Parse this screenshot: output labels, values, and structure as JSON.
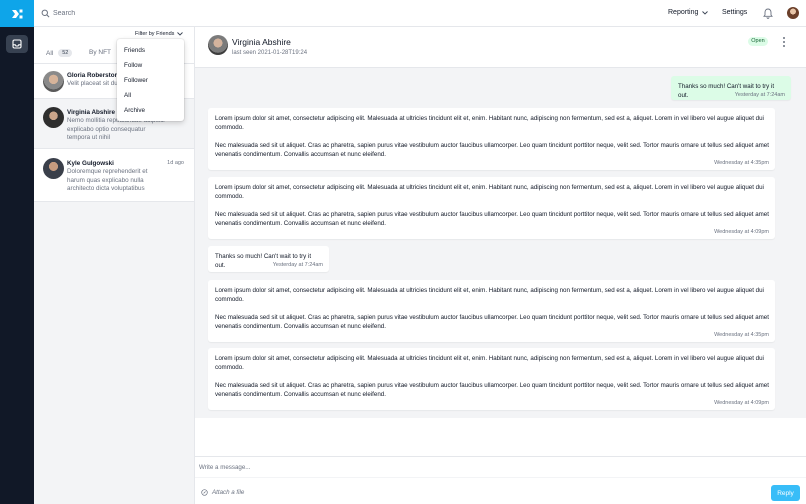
{
  "colors": {
    "brand": "#0ea5e9",
    "rail": "#111827",
    "open_badge_bg": "#dcfce7",
    "open_badge_text": "#166534",
    "reply": "#38bdf8"
  },
  "topbar": {
    "search_placeholder": "Search",
    "nav_reporting": "Reporting",
    "nav_settings": "Settings"
  },
  "sidebar": {
    "filter_label": "Filter by Friends",
    "tabs": [
      {
        "label": "All",
        "count": "52"
      },
      {
        "label": "By NFT"
      }
    ],
    "filter_options": [
      "Friends",
      "Follow",
      "Follower",
      "All",
      "Archive"
    ],
    "conversations": [
      {
        "name": "Gloria Roberston",
        "time": "",
        "preview": "Velit placeat sit du"
      },
      {
        "name": "Virginia Abshire",
        "time": "",
        "preview": "Nemo mollitia repudiandae adipisci explicabo optio consequatur tempora ut nihil"
      },
      {
        "name": "Kyle Gulgowski",
        "time": "1d ago",
        "preview": "Doloremque reprehenderit et harum quas explicabo nulla architecto dicta voluptatibus"
      }
    ]
  },
  "chat": {
    "contact_name": "Virginia Abshire",
    "last_seen": "last seen 2021-01-28T19:24",
    "status": "Open",
    "messages": [
      {
        "from": "me",
        "text": "Thanks so much! Can't wait to try it out.",
        "time": "Yesterday at 7:24am"
      },
      {
        "from": "them",
        "p1": "Lorem ipsum dolor sit amet, consectetur adipiscing elit. Malesuada at ultricies tincidunt elit et, enim. Habitant nunc, adipiscing non fermentum, sed est a, aliquet. Lorem in vel libero vel augue aliquet dui commodo.",
        "p2": "Nec malesuada sed sit ut aliquet. Cras ac pharetra, sapien purus vitae vestibulum auctor faucibus ullamcorper. Leo quam tincidunt porttitor neque, velit sed. Tortor mauris ornare ut tellus sed aliquet amet venenatis condimentum. Convallis accumsan et nunc eleifend.",
        "time": "Wednesday at 4:35pm"
      },
      {
        "from": "them",
        "p1": "Lorem ipsum dolor sit amet, consectetur adipiscing elit. Malesuada at ultricies tincidunt elit et, enim. Habitant nunc, adipiscing non fermentum, sed est a, aliquet. Lorem in vel libero vel augue aliquet dui commodo.",
        "p2": "Nec malesuada sed sit ut aliquet. Cras ac pharetra, sapien purus vitae vestibulum auctor faucibus ullamcorper. Leo quam tincidunt porttitor neque, velit sed. Tortor mauris ornare ut tellus sed aliquet amet venenatis condimentum. Convallis accumsan et nunc eleifend.",
        "time": "Wednesday at 4:09pm"
      },
      {
        "from": "them",
        "text": "Thanks so much! Can't wait to try it out.",
        "time": "Yesterday at 7:24am"
      },
      {
        "from": "them",
        "p1": "Lorem ipsum dolor sit amet, consectetur adipiscing elit. Malesuada at ultricies tincidunt elit et, enim. Habitant nunc, adipiscing non fermentum, sed est a, aliquet. Lorem in vel libero vel augue aliquet dui commodo.",
        "p2": "Nec malesuada sed sit ut aliquet. Cras ac pharetra, sapien purus vitae vestibulum auctor faucibus ullamcorper. Leo quam tincidunt porttitor neque, velit sed. Tortor mauris ornare ut tellus sed aliquet amet venenatis condimentum. Convallis accumsan et nunc eleifend.",
        "time": "Wednesday at 4:35pm"
      },
      {
        "from": "them",
        "p1": "Lorem ipsum dolor sit amet, consectetur adipiscing elit. Malesuada at ultricies tincidunt elit et, enim. Habitant nunc, adipiscing non fermentum, sed est a, aliquet. Lorem in vel libero vel augue aliquet dui commodo.",
        "p2": "Nec malesuada sed sit ut aliquet. Cras ac pharetra, sapien purus vitae vestibulum auctor faucibus ullamcorper. Leo quam tincidunt porttitor neque, velit sed. Tortor mauris ornare ut tellus sed aliquet amet venenatis condimentum. Convallis accumsan et nunc eleifend.",
        "time": "Wednesday at 4:09pm"
      }
    ]
  },
  "composer": {
    "placeholder": "Write a message...",
    "attach_label": "Attach a file",
    "reply_label": "Reply"
  }
}
